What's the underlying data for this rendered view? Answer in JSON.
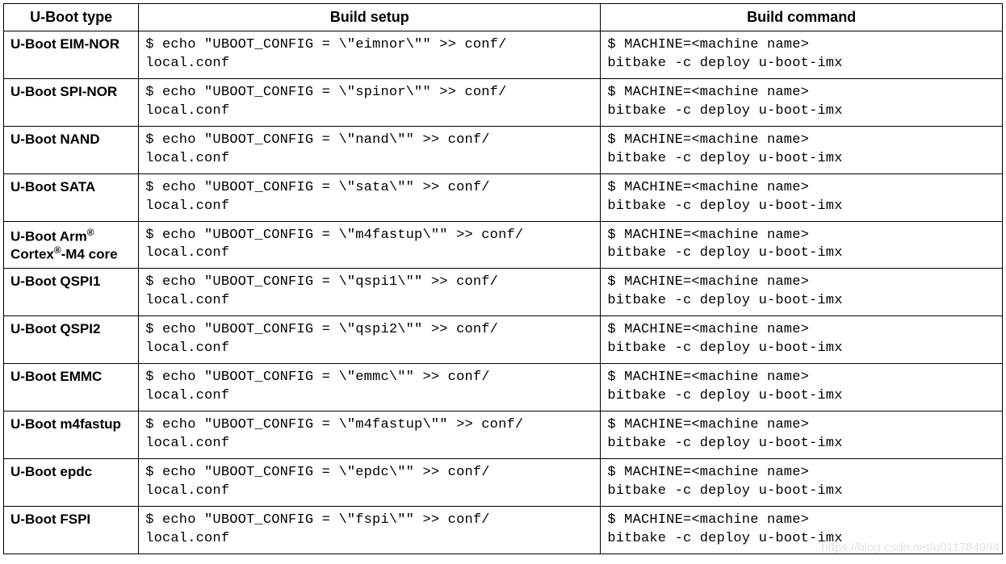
{
  "table": {
    "headers": [
      "U-Boot type",
      "Build setup",
      "Build command"
    ],
    "rows": [
      {
        "type": "U-Boot EIM-NOR",
        "setup": "$ echo \"UBOOT_CONFIG = \\\"eimnor\\\"\" >> conf/\nlocal.conf",
        "cmd": "$ MACHINE=<machine name>\nbitbake -c deploy u-boot-imx"
      },
      {
        "type": "U-Boot SPI-NOR",
        "setup": "$ echo \"UBOOT_CONFIG = \\\"spinor\\\"\" >> conf/\nlocal.conf",
        "cmd": "$ MACHINE=<machine name>\nbitbake -c deploy u-boot-imx"
      },
      {
        "type": "U-Boot NAND",
        "setup": "$ echo \"UBOOT_CONFIG = \\\"nand\\\"\" >> conf/\nlocal.conf",
        "cmd": "$ MACHINE=<machine name>\nbitbake -c deploy u-boot-imx"
      },
      {
        "type": "U-Boot SATA",
        "setup": "$ echo \"UBOOT_CONFIG = \\\"sata\\\"\" >> conf/\nlocal.conf",
        "cmd": "$ MACHINE=<machine name>\nbitbake -c deploy u-boot-imx"
      },
      {
        "type_html": "U-Boot Arm<sup>®</sup> Cortex<sup>®</sup>-M4 core",
        "type": "U-Boot Arm® Cortex®-M4 core",
        "setup": "$ echo \"UBOOT_CONFIG = \\\"m4fastup\\\"\" >> conf/\nlocal.conf",
        "cmd": "$ MACHINE=<machine name>\nbitbake -c deploy u-boot-imx"
      },
      {
        "type": "U-Boot QSPI1",
        "setup": "$ echo \"UBOOT_CONFIG = \\\"qspi1\\\"\" >> conf/\nlocal.conf",
        "cmd": "$ MACHINE=<machine name>\nbitbake -c deploy u-boot-imx"
      },
      {
        "type": "U-Boot QSPI2",
        "setup": "$ echo \"UBOOT_CONFIG = \\\"qspi2\\\"\" >> conf/\nlocal.conf",
        "cmd": "$ MACHINE=<machine name>\nbitbake -c deploy u-boot-imx"
      },
      {
        "type": "U-Boot EMMC",
        "setup": "$ echo \"UBOOT_CONFIG = \\\"emmc\\\"\" >> conf/\nlocal.conf",
        "cmd": "$ MACHINE=<machine name>\nbitbake -c deploy u-boot-imx"
      },
      {
        "type": "U-Boot m4fastup",
        "setup": "$ echo \"UBOOT_CONFIG = \\\"m4fastup\\\"\" >> conf/\nlocal.conf",
        "cmd": "$ MACHINE=<machine name>\nbitbake -c deploy u-boot-imx"
      },
      {
        "type": "U-Boot epdc",
        "setup": "$ echo \"UBOOT_CONFIG = \\\"epdc\\\"\" >> conf/\nlocal.conf",
        "cmd": "$ MACHINE=<machine name>\nbitbake -c deploy u-boot-imx"
      },
      {
        "type": "U-Boot FSPI",
        "setup": "$ echo \"UBOOT_CONFIG = \\\"fspi\\\"\" >> conf/\nlocal.conf",
        "cmd": "$ MACHINE=<machine name>\nbitbake -c deploy u-boot-imx"
      }
    ]
  },
  "watermark": "https://blog.csdn.net/u011784994"
}
